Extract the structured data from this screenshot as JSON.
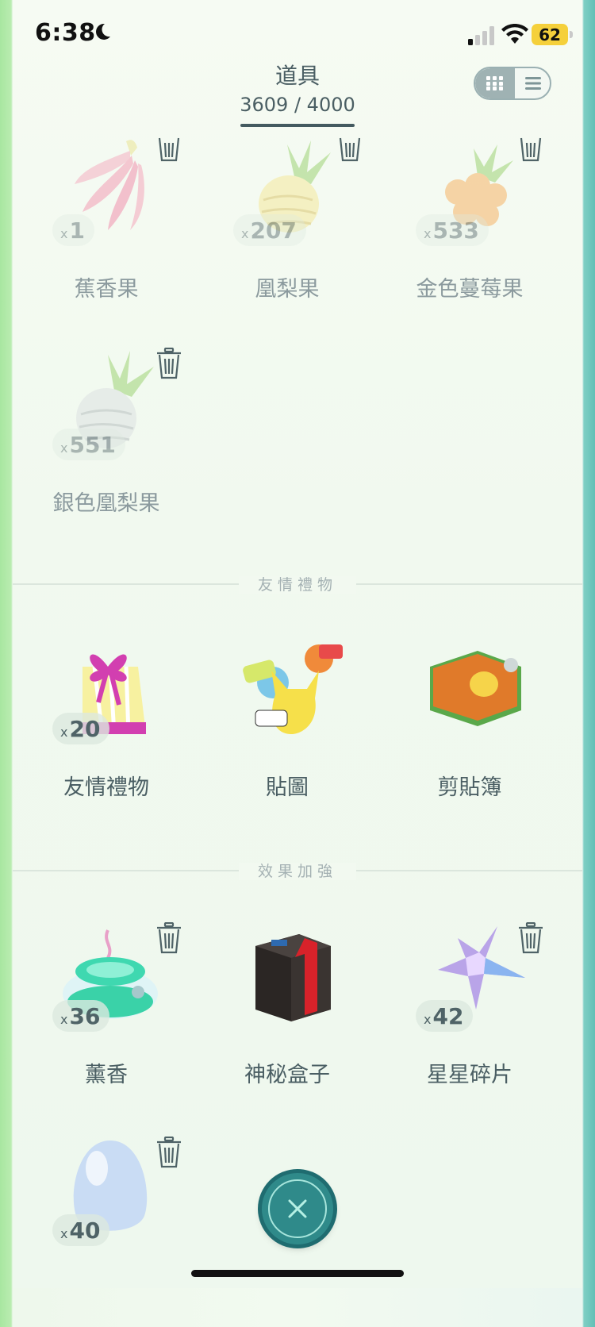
{
  "status_bar": {
    "time": "6:38",
    "battery": "62"
  },
  "header": {
    "title": "道具",
    "count": "3609 / 4000"
  },
  "sections": {
    "berries": [
      {
        "label": "蕉香果",
        "x": "x",
        "qty": "1"
      },
      {
        "label": "凰梨果",
        "x": "x",
        "qty": "207"
      },
      {
        "label": "金色蔓莓果",
        "x": "x",
        "qty": "533"
      },
      {
        "label": "銀色凰梨果",
        "x": "x",
        "qty": "551"
      }
    ],
    "friendship": {
      "title": "友情禮物",
      "items": [
        {
          "label": "友情禮物",
          "x": "x",
          "qty": "20"
        },
        {
          "label": "貼圖"
        },
        {
          "label": "剪貼簿"
        }
      ]
    },
    "boosts": {
      "title": "效果加強",
      "items": [
        {
          "label": "薰香",
          "x": "x",
          "qty": "36"
        },
        {
          "label": "神秘盒子"
        },
        {
          "label": "星星碎片",
          "x": "x",
          "qty": "42"
        },
        {
          "label": "",
          "x": "x",
          "qty": "40"
        }
      ]
    }
  },
  "colors": {
    "accent": "#2f8a8a",
    "text": "#4a5e63",
    "battery": "#f5d03b"
  }
}
